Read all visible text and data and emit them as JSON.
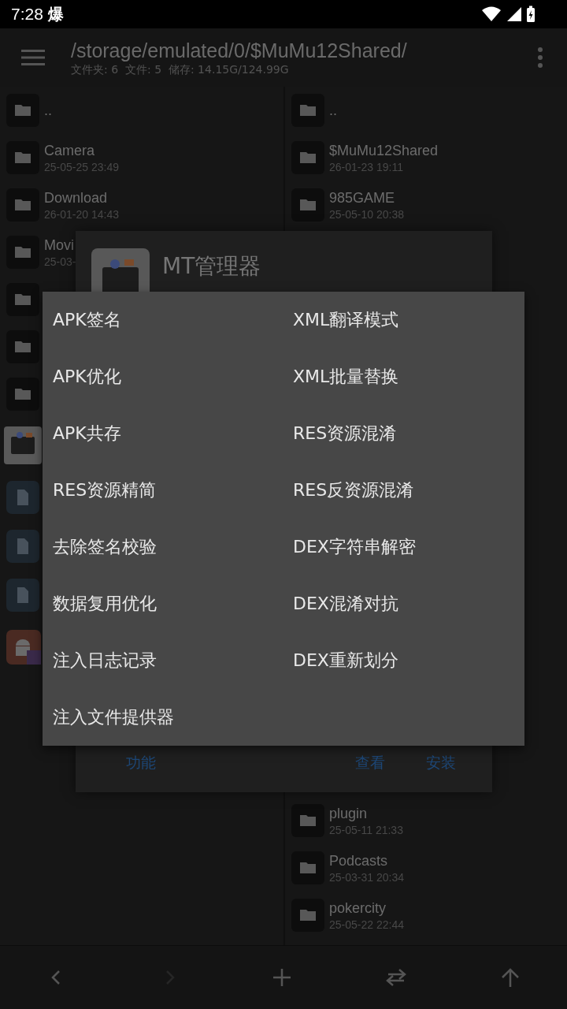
{
  "status_bar": {
    "time": "7:28",
    "notification": "爆"
  },
  "toolbar": {
    "path": "/storage/emulated/0/$MuMu12Shared/",
    "info": "文件夹: 6  文件: 5  储存: 14.15G/124.99G"
  },
  "left_pane": {
    "rows": [
      {
        "kind": "folder",
        "name": ".."
      },
      {
        "kind": "folder",
        "name": "Camera",
        "date": "25-05-25 23:49"
      },
      {
        "kind": "folder",
        "name": "Download",
        "date": "26-01-20 14:43"
      },
      {
        "kind": "folder",
        "name": "Movi",
        "date": "25-03-"
      },
      {
        "kind": "folder"
      },
      {
        "kind": "folder"
      },
      {
        "kind": "folder"
      },
      {
        "kind": "apk"
      },
      {
        "kind": "file"
      },
      {
        "kind": "file"
      },
      {
        "kind": "file"
      },
      {
        "kind": "android"
      }
    ]
  },
  "right_pane": {
    "top_rows": [
      {
        "kind": "folder",
        "name": ".."
      },
      {
        "kind": "folder",
        "name": "$MuMu12Shared",
        "date": "26-01-23 19:11"
      },
      {
        "kind": "folder",
        "name": "985GAME",
        "date": "25-05-10 20:38"
      }
    ],
    "bottom_rows": [
      {
        "kind": "folder",
        "name": "plugin",
        "date": "25-05-11 21:33"
      },
      {
        "kind": "folder",
        "name": "Podcasts",
        "date": "25-03-31 20:34"
      },
      {
        "kind": "folder",
        "name": "pokercity",
        "date": "25-05-22 22:44"
      }
    ]
  },
  "dialog": {
    "title": "MT管理器",
    "buttons": [
      {
        "label": "功能"
      },
      {
        "label": "查看"
      },
      {
        "label": "安装"
      }
    ]
  },
  "menu": {
    "items": [
      "APK签名",
      "XML翻译模式",
      "APK优化",
      "XML批量替换",
      "APK共存",
      "RES资源混淆",
      "RES资源精简",
      "RES反资源混淆",
      "去除签名校验",
      "DEX字符串解密",
      "数据复用优化",
      "DEX混淆对抗",
      "注入日志记录",
      "DEX重新划分",
      "注入文件提供器"
    ]
  },
  "bottom_bar": {
    "buttons": [
      {
        "kind": "back",
        "disabled": false
      },
      {
        "kind": "forward",
        "disabled": true
      },
      {
        "kind": "add",
        "disabled": false
      },
      {
        "kind": "swap",
        "disabled": false
      },
      {
        "kind": "up",
        "disabled": false
      }
    ]
  }
}
